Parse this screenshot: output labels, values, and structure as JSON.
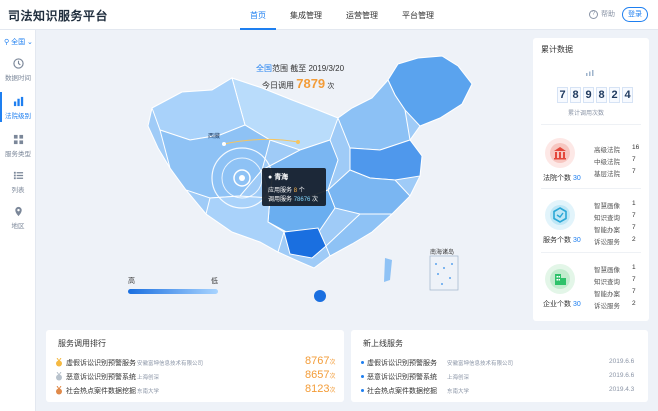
{
  "header": {
    "logo": "司法知识服务平台",
    "nav": [
      "首页",
      "集成管理",
      "运营管理",
      "平台管理"
    ],
    "help": "帮助",
    "login": "登录"
  },
  "sidebar": {
    "region": "全国",
    "items": [
      {
        "label": "数据时间",
        "icon": "clock-icon"
      },
      {
        "label": "法院级别",
        "icon": "bar-chart-icon"
      },
      {
        "label": "服务类型",
        "icon": "grid-icon"
      },
      {
        "label": "列表",
        "icon": "list-icon"
      },
      {
        "label": "地区",
        "icon": "location-pin-icon"
      }
    ]
  },
  "map": {
    "scope_prefix": "全国",
    "scope_text": "范围 截至 2019/3/20",
    "today_label": "今日调用",
    "today_value": "7879",
    "today_unit": "次",
    "label_xizang": "西藏",
    "tooltip": {
      "title": "青海",
      "app_label": "应用服务",
      "app_value": "8",
      "app_unit": "个",
      "call_label": "调用服务",
      "call_value": "78676",
      "call_unit": "次"
    },
    "scs_label": "南海诸岛",
    "legend_high": "高",
    "legend_low": "低"
  },
  "stats": {
    "title": "累计数据",
    "digits": [
      "7",
      "8",
      "9",
      "8",
      "2",
      "4"
    ],
    "digits_caption": "累计调用次数",
    "courts": {
      "caption": "法院个数",
      "count": "30",
      "rows": [
        {
          "label": "高级法院",
          "value": "16"
        },
        {
          "label": "中级法院",
          "value": "7"
        },
        {
          "label": "基层法院",
          "value": "7"
        }
      ]
    },
    "services": {
      "caption": "服务个数",
      "count": "30",
      "rows": [
        {
          "label": "智慧画像",
          "value": "1"
        },
        {
          "label": "知识查询",
          "value": "7"
        },
        {
          "label": "智能办案",
          "value": "7"
        },
        {
          "label": "诉讼服务",
          "value": "2"
        }
      ]
    },
    "companies": {
      "caption": "企业个数",
      "count": "30",
      "rows": [
        {
          "label": "智慧画像",
          "value": "1"
        },
        {
          "label": "知识查询",
          "value": "7"
        },
        {
          "label": "智能办案",
          "value": "7"
        },
        {
          "label": "诉讼服务",
          "value": "2"
        }
      ]
    }
  },
  "ranking": {
    "title": "服务调用排行",
    "rows": [
      {
        "name": "虚假诉讼识别预警服务",
        "org": "安徽富坤信息技术有限公司",
        "value": "8767",
        "unit": "次"
      },
      {
        "name": "恶意诉讼识别预警系统",
        "org": "上海创深",
        "value": "8657",
        "unit": "次"
      },
      {
        "name": "社会热点案件数据挖掘",
        "org": "东南大学",
        "value": "8123",
        "unit": "次"
      }
    ]
  },
  "new_services": {
    "title": "新上线服务",
    "rows": [
      {
        "name": "虚假诉讼识别预警服务",
        "org": "安徽富坤信息技术有限公司",
        "date": "2019.6.6"
      },
      {
        "name": "恶意诉讼识别预警系统",
        "org": "上海创深",
        "date": "2019.6.6"
      },
      {
        "name": "社会热点案件数据挖掘",
        "org": "东南大学",
        "date": "2019.4.3"
      }
    ]
  },
  "colors": {
    "accent": "#1e7ff0",
    "highlight_orange": "#f39c38",
    "map_light": "#a8d4ff",
    "map_dark": "#1a6fe0"
  }
}
